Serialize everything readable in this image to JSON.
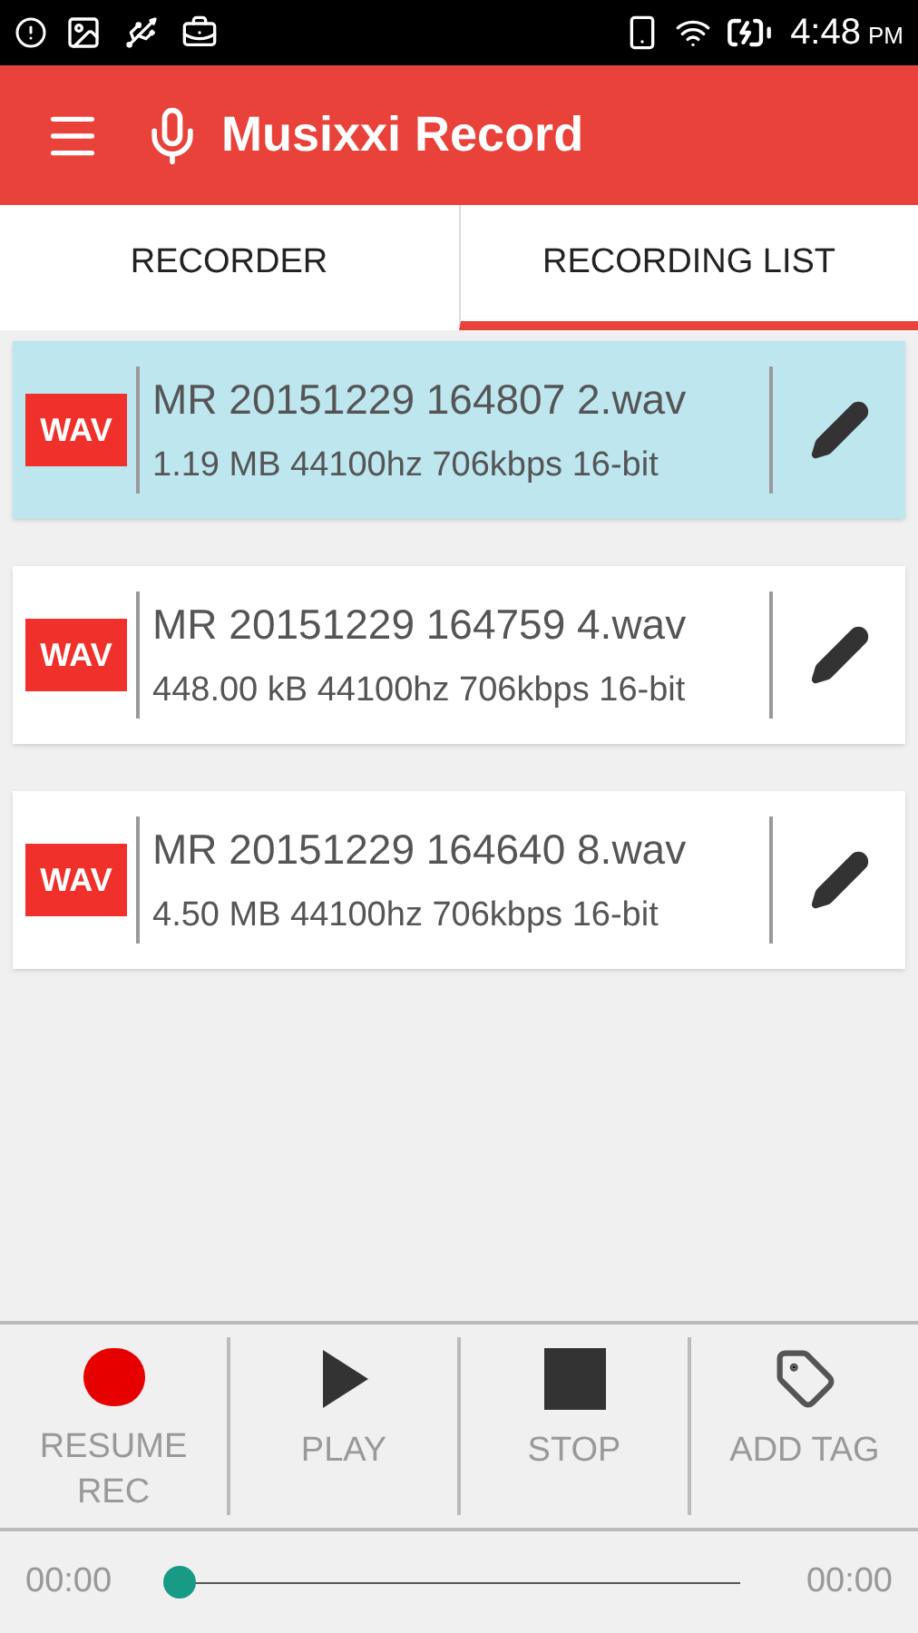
{
  "status_bar": {
    "time": "4:48",
    "ampm": "PM"
  },
  "app_bar": {
    "title": "Musixxi Record"
  },
  "tabs": [
    {
      "label": "RECORDER",
      "selected": false
    },
    {
      "label": "RECORDING LIST",
      "selected": true
    }
  ],
  "recordings": [
    {
      "format": "WAV",
      "name": "MR 20151229 164807 2.wav",
      "details": "1.19 MB 44100hz 706kbps 16-bit",
      "selected": true
    },
    {
      "format": "WAV",
      "name": "MR 20151229 164759 4.wav",
      "details": "448.00 kB 44100hz 706kbps 16-bit",
      "selected": false
    },
    {
      "format": "WAV",
      "name": "MR 20151229 164640 8.wav",
      "details": "4.50 MB 44100hz 706kbps 16-bit",
      "selected": false
    }
  ],
  "controls": [
    {
      "kind": "record",
      "label": "RESUME REC"
    },
    {
      "kind": "play",
      "label": "PLAY"
    },
    {
      "kind": "stop",
      "label": "STOP"
    },
    {
      "kind": "tag",
      "label": "ADD TAG"
    }
  ],
  "player": {
    "elapsed": "00:00",
    "total": "00:00",
    "level": 0
  }
}
